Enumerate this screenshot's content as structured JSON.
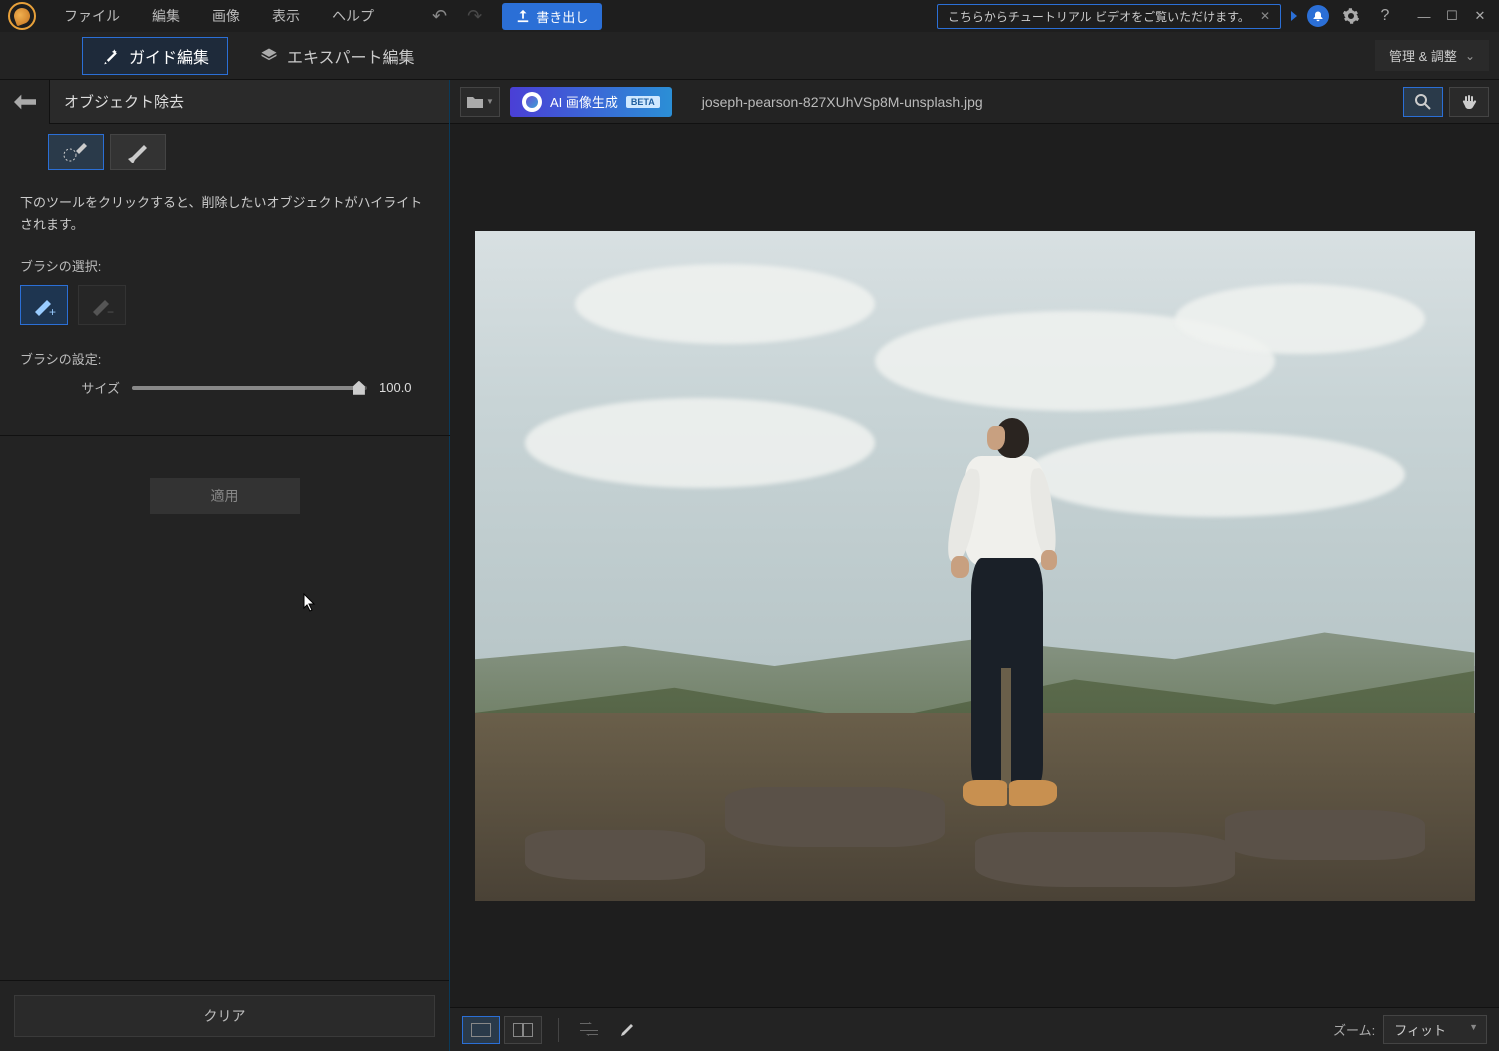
{
  "menu": {
    "file": "ファイル",
    "edit": "編集",
    "image": "画像",
    "view": "表示",
    "help": "ヘルプ"
  },
  "export_label": "書き出し",
  "tutorial_text": "こちらからチュートリアル ビデオをご覧いただけます。",
  "mode": {
    "guide": "ガイド編集",
    "expert": "エキスパート編集",
    "manage": "管理 & 調整"
  },
  "panel": {
    "title": "オブジェクト除去",
    "instruction": "下のツールをクリックすると、削除したいオブジェクトがハイライトされます。",
    "brush_select_label": "ブラシの選択:",
    "brush_settings_label": "ブラシの設定:",
    "size_label": "サイズ",
    "size_value": "100.0",
    "apply": "適用",
    "clear": "クリア"
  },
  "ai_button": {
    "label": "AI 画像生成",
    "badge": "BETA"
  },
  "filename": "joseph-pearson-827XUhVSp8M-unsplash.jpg",
  "bottom": {
    "zoom_label": "ズーム:",
    "zoom_value": "フィット"
  }
}
